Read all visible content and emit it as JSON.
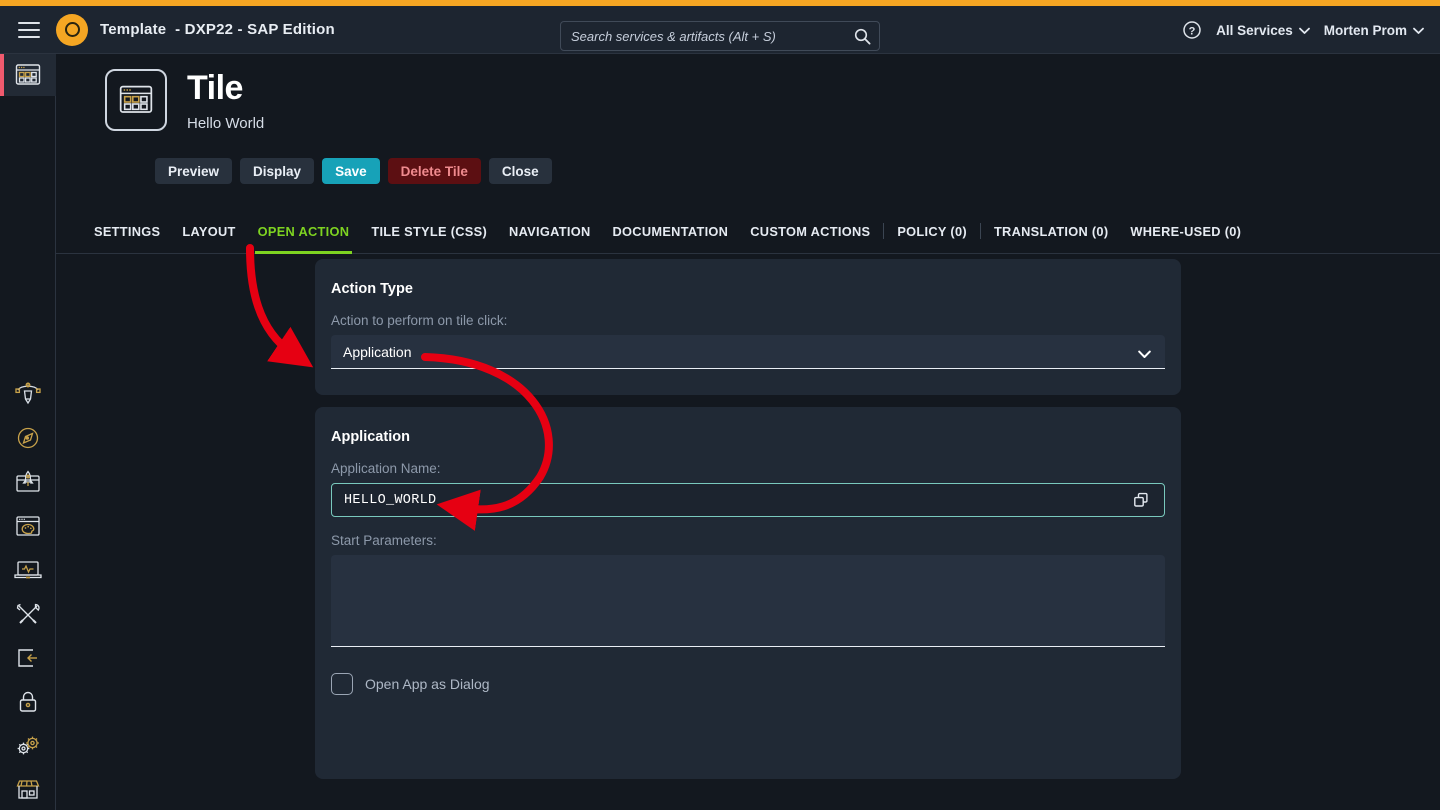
{
  "header": {
    "menu_icon": "hamburger-menu-icon",
    "logo_icon": "brand-circle-logo",
    "app_title": "Template",
    "app_title_suffix": "- DXP22 - SAP Edition",
    "search": {
      "placeholder": "Search services & artifacts (Alt + S)",
      "value": "",
      "icon": "search-icon"
    },
    "help_icon": "help-circle-icon",
    "all_services_label": "All Services",
    "user_label": "Morten Prom",
    "chevron_icon": "chevron-down-icon"
  },
  "sidebar": {
    "active_item": "tile-icon",
    "items": [
      {
        "icon": "tile-grid-icon",
        "active": true
      },
      {
        "icon": "pen-nib-icon"
      },
      {
        "icon": "compass-icon"
      },
      {
        "icon": "rocket-window-icon"
      },
      {
        "icon": "palette-window-icon"
      },
      {
        "icon": "laptop-monitor-icon"
      },
      {
        "icon": "tools-icon"
      },
      {
        "icon": "login-box-icon"
      },
      {
        "icon": "lock-icon"
      },
      {
        "icon": "gears-icon"
      },
      {
        "icon": "storefront-icon"
      }
    ]
  },
  "page": {
    "icon": "tile-grid-icon",
    "title": "Tile",
    "subtitle": "Hello World",
    "buttons": [
      {
        "label": "Preview",
        "style": "default",
        "name": "preview-button"
      },
      {
        "label": "Display",
        "style": "default",
        "name": "display-button"
      },
      {
        "label": "Save",
        "style": "save",
        "name": "save-button"
      },
      {
        "label": "Delete Tile",
        "style": "delete",
        "name": "delete-tile-button"
      },
      {
        "label": "Close",
        "style": "default",
        "name": "close-button"
      }
    ],
    "tabs": [
      {
        "label": "SETTINGS",
        "active": false,
        "sep_after": false
      },
      {
        "label": "LAYOUT",
        "active": false,
        "sep_after": false
      },
      {
        "label": "OPEN ACTION",
        "active": true,
        "sep_after": false
      },
      {
        "label": "TILE STYLE (CSS)",
        "active": false,
        "sep_after": false
      },
      {
        "label": "NAVIGATION",
        "active": false,
        "sep_after": false
      },
      {
        "label": "DOCUMENTATION",
        "active": false,
        "sep_after": false
      },
      {
        "label": "CUSTOM ACTIONS",
        "active": false,
        "sep_after": true
      },
      {
        "label": "POLICY (0)",
        "active": false,
        "sep_after": true
      },
      {
        "label": "TRANSLATION (0)",
        "active": false,
        "sep_after": false
      },
      {
        "label": "WHERE-USED (0)",
        "active": false,
        "sep_after": false
      }
    ]
  },
  "action_type_panel": {
    "title": "Action Type",
    "field_label": "Action to perform on tile click:",
    "selected_value": "Application",
    "options": [
      "Application"
    ]
  },
  "application_panel": {
    "title": "Application",
    "app_name_label": "Application Name:",
    "app_name_value": "HELLO_WORLD",
    "copy_icon": "copy-icon",
    "start_params_label": "Start Parameters:",
    "start_params_value": "",
    "open_as_dialog_label": "Open App as Dialog",
    "open_as_dialog_checked": false
  },
  "colors": {
    "accent_orange": "#f5a623",
    "accent_green": "#7ed321",
    "save_teal": "#17a2b8",
    "delete_red": "#5c0f12",
    "focus_teal": "#79c9bd",
    "annotation_red": "#e60012",
    "active_marker_pink": "#f05a6e"
  },
  "annotations": [
    {
      "name": "arrow-to-action-type-dropdown",
      "color": "#e60012"
    },
    {
      "name": "arrow-to-application-name-field",
      "color": "#e60012"
    }
  ]
}
